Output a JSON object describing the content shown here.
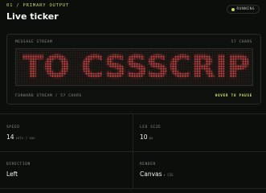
{
  "header": {
    "kicker": "01 / PRIMARY OUTPUT",
    "title": "Live ticker",
    "status": "RUNNING"
  },
  "ticker": {
    "top_left": "MESSAGE STREAM",
    "top_right": "57 CHARS",
    "display_text": "TO CSSSCRIP",
    "bottom_left": "FORWARD STREAM / 57 CHARS",
    "hover_hint": "HOVER TO PAUSE"
  },
  "settings": [
    {
      "label": "SPEED",
      "value": "14",
      "unit": "cols / sec"
    },
    {
      "label": "LED SIZE",
      "value": "10",
      "unit": "px"
    },
    {
      "label": "DIRECTION",
      "value": "Left",
      "unit": ""
    },
    {
      "label": "RENDER",
      "value": "Canvas",
      "unit": "+ CSS"
    }
  ],
  "colors": {
    "accent": "#c9d86a",
    "led": "#e2494a",
    "background": "#0b0e0a"
  }
}
